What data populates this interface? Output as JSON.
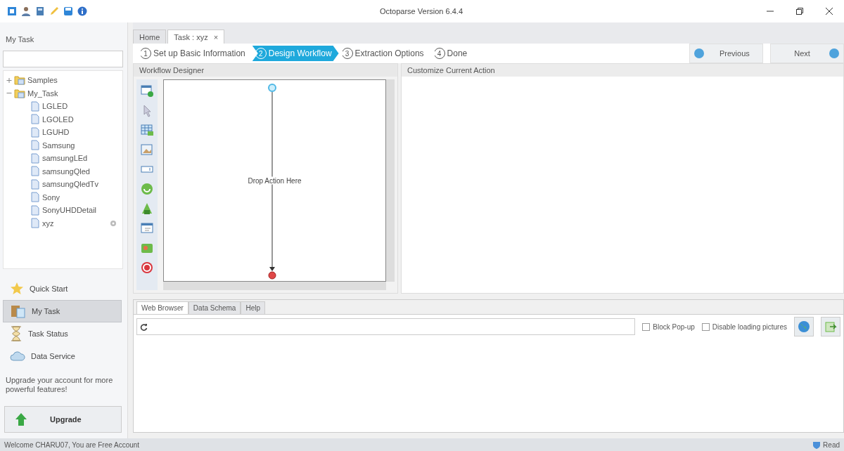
{
  "window": {
    "title": "Octoparse Version 6.4.4"
  },
  "sidebar": {
    "title": "My Task",
    "tree": [
      {
        "label": "Samples",
        "expanded": false
      },
      {
        "label": "My_Task",
        "expanded": true,
        "children": [
          {
            "label": "LGLED"
          },
          {
            "label": "LGOLED"
          },
          {
            "label": "LGUHD"
          },
          {
            "label": "Samsung"
          },
          {
            "label": "samsungLEd"
          },
          {
            "label": "samsungQled"
          },
          {
            "label": "samsungQledTv"
          },
          {
            "label": "Sony"
          },
          {
            "label": "SonyUHDDetail"
          },
          {
            "label": "xyz"
          }
        ]
      }
    ],
    "nav": [
      {
        "label": "Quick Start",
        "kind": "star",
        "selected": false
      },
      {
        "label": "My Task",
        "kind": "folder",
        "selected": true
      },
      {
        "label": "Task Status",
        "kind": "hourglass",
        "selected": false
      },
      {
        "label": "Data Service",
        "kind": "cloud",
        "selected": false
      }
    ],
    "upgrade_note": "Upgrade your account for more powerful features!",
    "upgrade_button": "Upgrade"
  },
  "doc_tabs": [
    {
      "label": "Home",
      "selected": false
    },
    {
      "label": "Task : xyz",
      "selected": true,
      "close": "×"
    }
  ],
  "steps": [
    {
      "number": "1",
      "label": "Set up Basic Information",
      "selected": false
    },
    {
      "number": "2",
      "label": "Design Workflow",
      "selected": true
    },
    {
      "number": "3",
      "label": "Extraction Options",
      "selected": false
    },
    {
      "number": "4",
      "label": "Done",
      "selected": false
    }
  ],
  "previous_button": "Previous",
  "next_button": "Next",
  "workflow": {
    "title": "Workflow Designer",
    "drop_hint": "Drop Action Here"
  },
  "action_panel": {
    "title": "Customize Current Action"
  },
  "bottom_tabs": [
    {
      "label": "Web Browser",
      "selected": true
    },
    {
      "label": "Data Schema",
      "selected": false
    },
    {
      "label": "Help",
      "selected": false
    }
  ],
  "browser_options": [
    {
      "label": "Block Pop-up",
      "checked": false
    },
    {
      "label": "Disable loading pictures",
      "checked": false
    }
  ],
  "status_bar": {
    "message": "Welcome CHARU07, You are Free Account",
    "state": "Read"
  }
}
